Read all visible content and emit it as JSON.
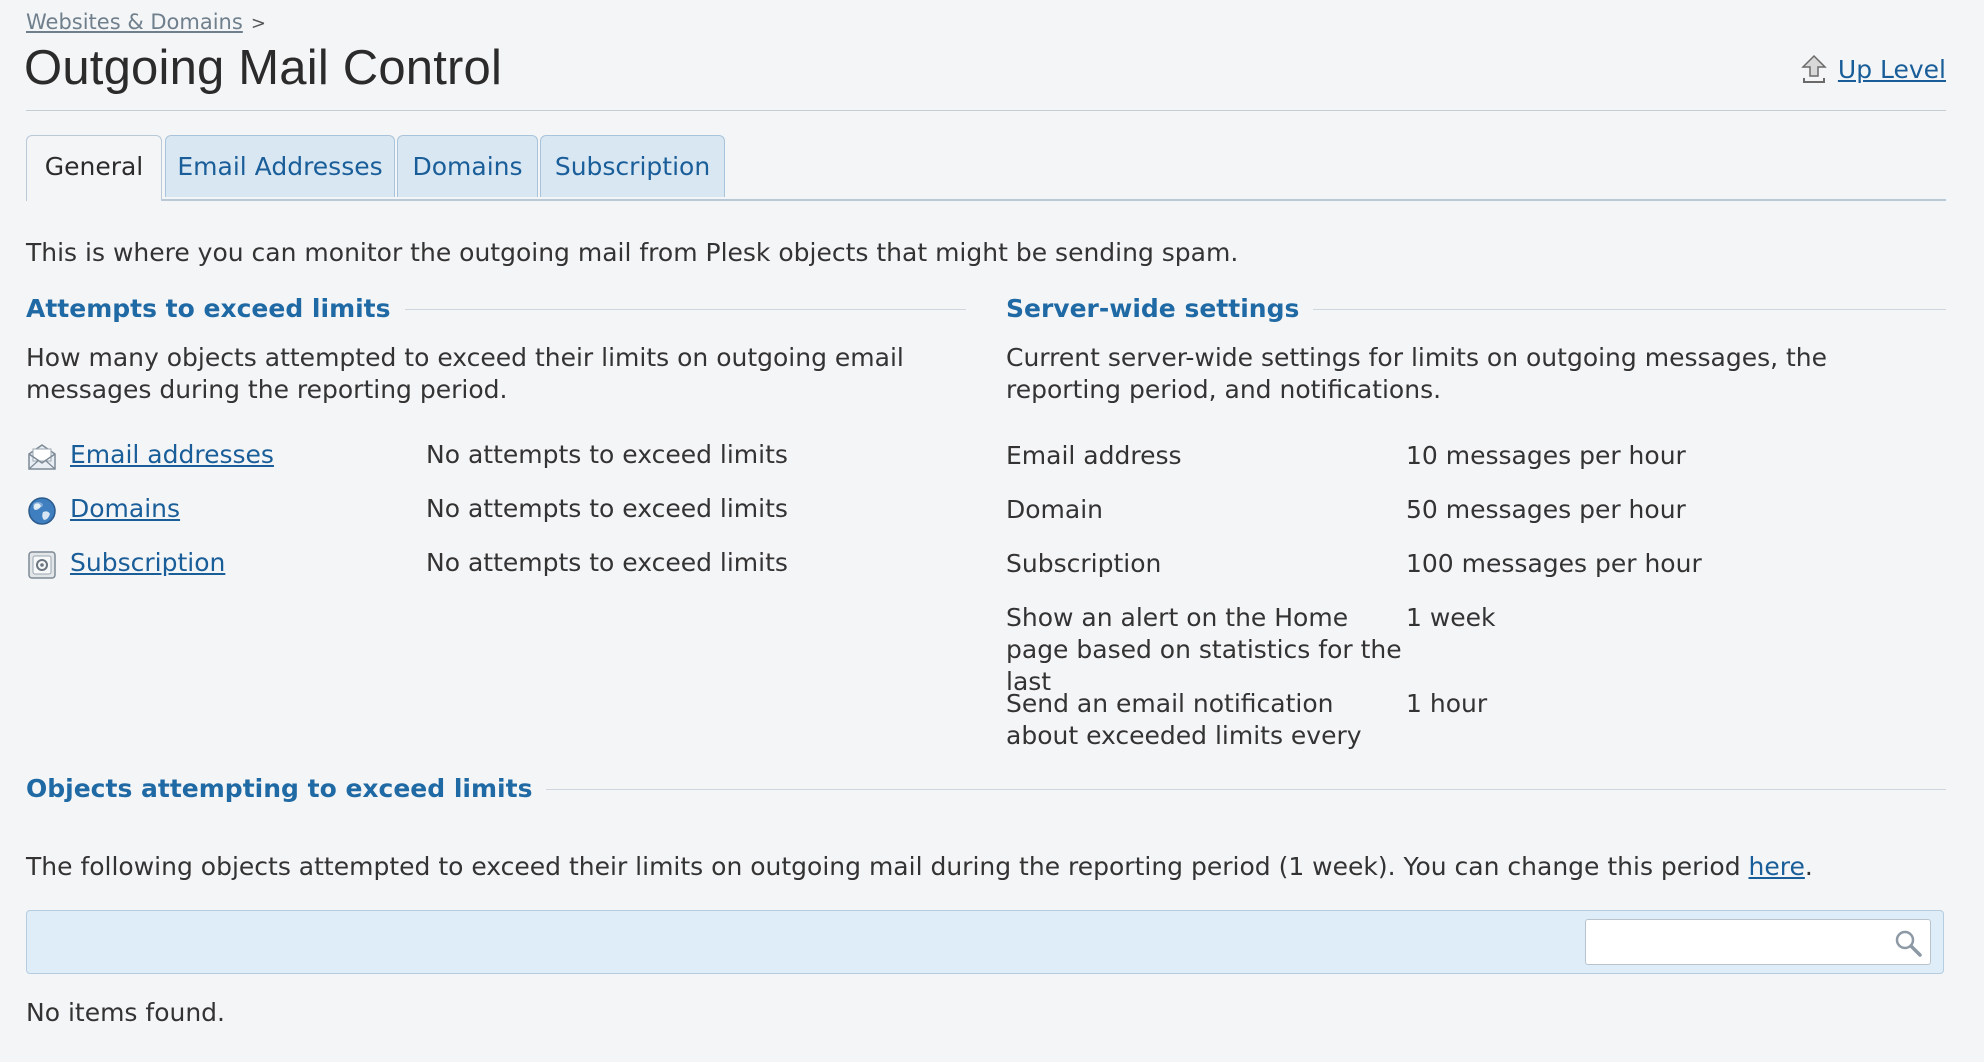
{
  "breadcrumb": {
    "items": [
      {
        "label": "Websites & Domains"
      }
    ],
    "separator": ">"
  },
  "page": {
    "title": "Outgoing Mail Control",
    "up_level_label": "Up Level"
  },
  "tabs": [
    {
      "label": "General",
      "active": true
    },
    {
      "label": "Email Addresses",
      "active": false
    },
    {
      "label": "Domains",
      "active": false
    },
    {
      "label": "Subscription",
      "active": false
    }
  ],
  "intro_text": "This is where you can monitor the outgoing mail from Plesk objects that might be sending spam.",
  "attempts": {
    "title": "Attempts to exceed limits",
    "description": "How many objects attempted to exceed their limits on outgoing email messages during the reporting period.",
    "rows": [
      {
        "label": "Email addresses",
        "icon": "envelope-icon",
        "status": "No attempts to exceed limits"
      },
      {
        "label": "Domains",
        "icon": "globe-icon",
        "status": "No attempts to exceed limits"
      },
      {
        "label": "Subscription",
        "icon": "subscription-icon",
        "status": "No attempts to exceed limits"
      }
    ]
  },
  "server_settings": {
    "title": "Server-wide settings",
    "description": "Current server-wide settings for limits on outgoing messages, the reporting period, and notifications.",
    "rows": [
      {
        "label": "Email address",
        "value": "10 messages per hour"
      },
      {
        "label": "Domain",
        "value": "50 messages per hour"
      },
      {
        "label": "Subscription",
        "value": "100 messages per hour"
      },
      {
        "label": "Show an alert on the Home page based on statistics for the last",
        "value": "1 week"
      },
      {
        "label": "Send an email notification about exceeded limits every",
        "value": "1 hour"
      }
    ]
  },
  "objects": {
    "title": "Objects attempting to exceed limits",
    "description_prefix": "The following objects attempted to exceed their limits on outgoing mail during the reporting period (1 week). You can change this period ",
    "description_link": "here",
    "description_suffix": ".",
    "search": {
      "value": "",
      "placeholder": ""
    },
    "empty_text": "No items found."
  },
  "colors": {
    "link": "#1a5e99",
    "section_heading": "#1f6aa5",
    "tab_inactive_bg": "#d9e7f3",
    "toolbar_bg": "#dfedf8",
    "page_bg": "#f4f5f7"
  }
}
